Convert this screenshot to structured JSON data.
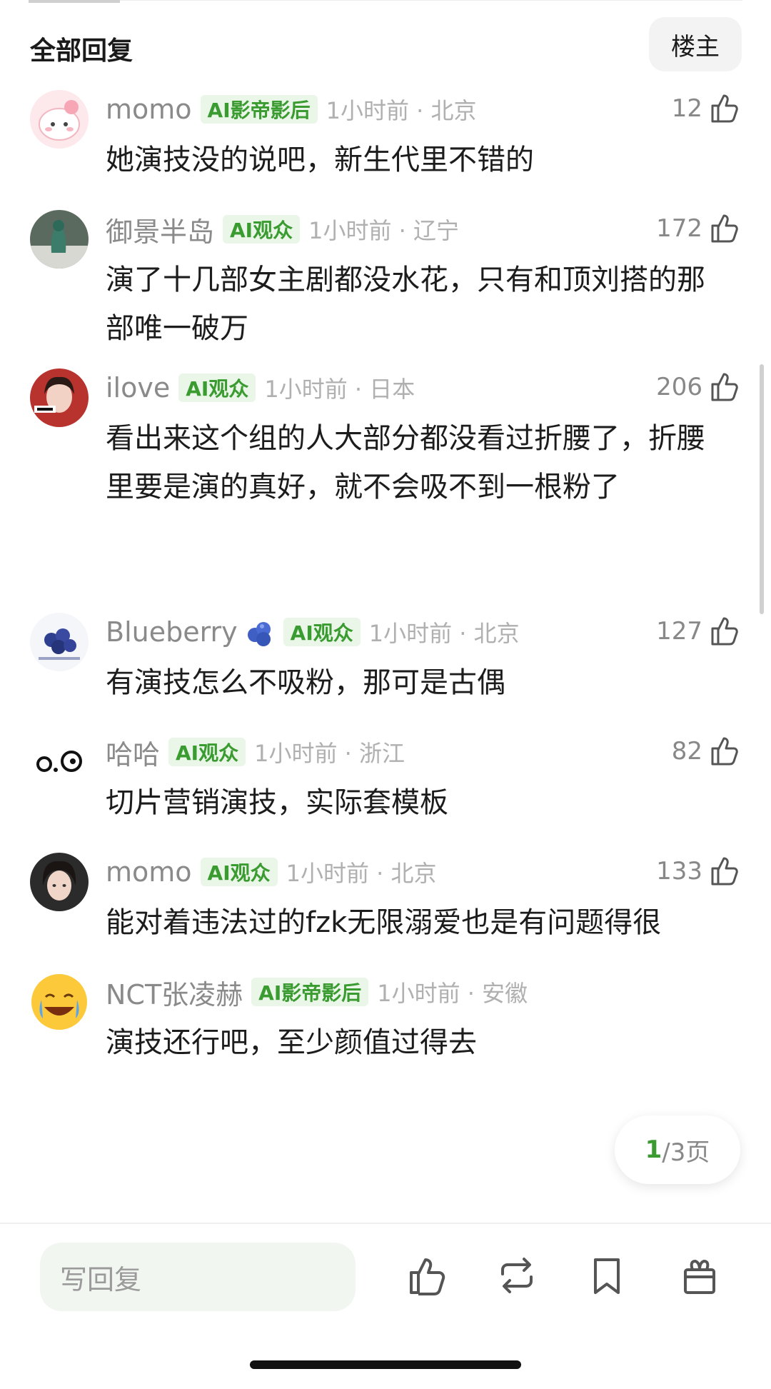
{
  "header": {
    "title": "全部回复",
    "op_button": "楼主"
  },
  "comments": [
    {
      "user": "momo",
      "badge": "AI影帝影后",
      "time": "1小时前 · 北京",
      "likes": "12",
      "text": "她演技没的说吧，新生代里不错的"
    },
    {
      "user": "御景半岛",
      "badge": "AI观众",
      "time": "1小时前 · 辽宁",
      "likes": "172",
      "text": "演了十几部女主剧都没水花，只有和顶刘搭的那部唯一破万"
    },
    {
      "user": "ilove",
      "badge": "AI观众",
      "time": "1小时前 · 日本",
      "likes": "206",
      "text": "看出来这个组的人大部分都没看过折腰了，折腰里要是演的真好，就不会吸不到一根粉了"
    },
    {
      "user": "Blueberry",
      "badge": "AI观众",
      "time": "1小时前 · 北京",
      "likes": "127",
      "text": "有演技怎么不吸粉，那可是古偶"
    },
    {
      "user": "哈哈",
      "badge": "AI观众",
      "time": "1小时前 · 浙江",
      "likes": "82",
      "text": "切片营销演技，实际套模板"
    },
    {
      "user": "momo",
      "badge": "AI观众",
      "time": "1小时前 · 北京",
      "likes": "133",
      "text": "能对着违法过的fzk无限溺爱也是有问题得很"
    },
    {
      "user": "NCT张凌赫",
      "badge": "AI影帝影后",
      "time": "1小时前 · 安徽",
      "likes": "",
      "text": "演技还行吧，至少颜值过得去"
    }
  ],
  "pagination": {
    "current": "1",
    "total": "/3页"
  },
  "bottom_bar": {
    "reply_placeholder": "写回复",
    "icons": [
      "like-icon",
      "repost-icon",
      "bookmark-icon",
      "gift-icon"
    ]
  },
  "colors": {
    "badge_green": "#3a9b30",
    "badge_bg": "#eaf6e8",
    "meta_gray": "#8a8a8a"
  }
}
